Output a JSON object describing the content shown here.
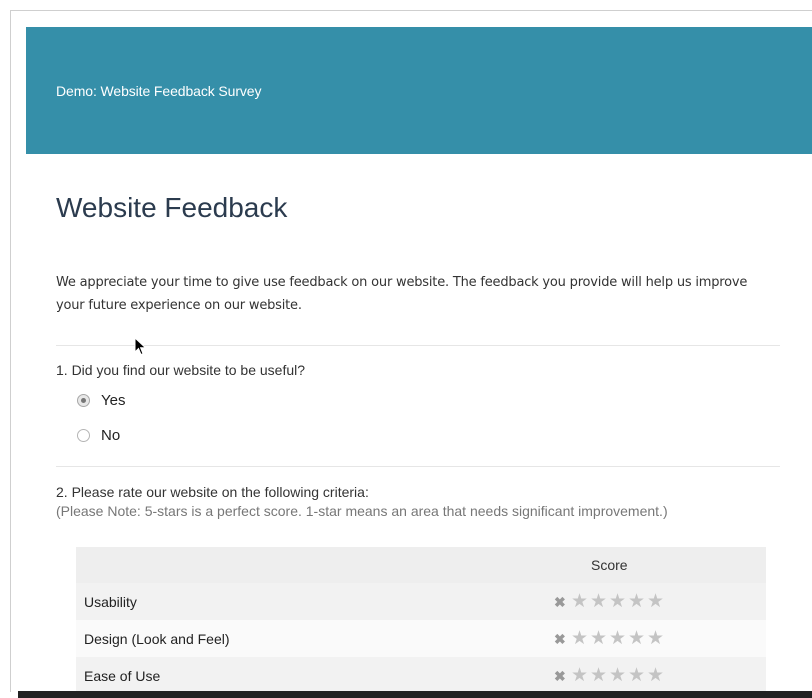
{
  "header": {
    "title": "Demo: Website Feedback Survey"
  },
  "survey": {
    "title": "Website Feedback",
    "intro": "We appreciate your time to give use feedback on our website. The feedback you provide will help us improve your future experience on our website."
  },
  "question1": {
    "text": "1. Did you find our website to be useful?",
    "options": [
      {
        "label": "Yes",
        "selected": true
      },
      {
        "label": "No",
        "selected": false
      }
    ]
  },
  "question2": {
    "text": "2. Please rate our website on the following criteria:",
    "note": "(Please Note: 5-stars is a perfect score. 1-star means an area that needs significant improvement.)",
    "score_header": "Score",
    "rows": [
      {
        "label": "Usability",
        "rating": 0,
        "max": 5
      },
      {
        "label": "Design (Look and Feel)",
        "rating": 0,
        "max": 5
      },
      {
        "label": "Ease of Use",
        "rating": 0,
        "max": 5
      }
    ]
  },
  "colors": {
    "header_bg": "#358fa9",
    "title_color": "#2b3b4e",
    "star_empty": "#c4c4c4"
  }
}
